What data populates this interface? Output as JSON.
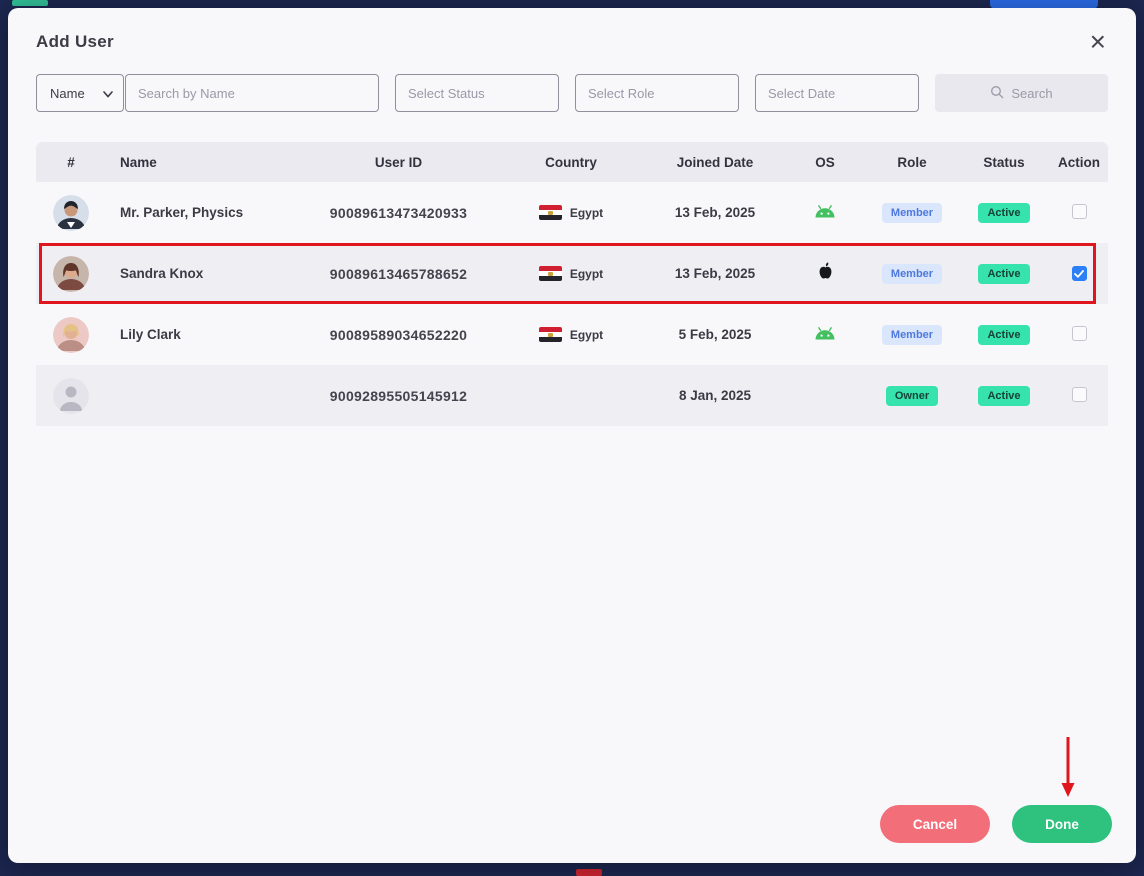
{
  "modal": {
    "title": "Add User"
  },
  "icons": {
    "close": "×"
  },
  "filters": {
    "name_dropdown": {
      "label": "Name"
    },
    "search_input": {
      "placeholder": "Search by Name",
      "value": ""
    },
    "status_input": {
      "placeholder": "Select Status",
      "value": ""
    },
    "role_input": {
      "placeholder": "Select Role",
      "value": ""
    },
    "date_input": {
      "placeholder": "Select Date",
      "value": ""
    },
    "search_button": {
      "label": "Search"
    }
  },
  "table": {
    "columns": [
      "#",
      "Name",
      "User ID",
      "Country",
      "Joined Date",
      "OS",
      "Role",
      "Status",
      "Action"
    ],
    "rows": [
      {
        "name": "Mr. Parker, Physics",
        "user_id": "90089613473420933",
        "country": "Egypt",
        "joined": "13 Feb, 2025",
        "os": "android",
        "role": "Member",
        "status": "Active",
        "checked": false
      },
      {
        "name": "Sandra Knox",
        "user_id": "90089613465788652",
        "country": "Egypt",
        "joined": "13 Feb, 2025",
        "os": "apple",
        "role": "Member",
        "status": "Active",
        "checked": true,
        "highlighted": true
      },
      {
        "name": "Lily Clark",
        "user_id": "90089589034652220",
        "country": "Egypt",
        "joined": "5 Feb, 2025",
        "os": "android",
        "role": "Member",
        "status": "Active",
        "checked": false
      },
      {
        "name": "",
        "user_id": "90092895505145912",
        "country": "",
        "joined": "8 Jan, 2025",
        "os": "",
        "role": "Owner",
        "status": "Active",
        "checked": false
      }
    ]
  },
  "footer": {
    "cancel_label": "Cancel",
    "done_label": "Done"
  },
  "colors": {
    "accent_blue": "#2d7ff7",
    "active_green": "#36e3ac",
    "member_blue": "#4f78dd",
    "cancel_red": "#f26e79",
    "done_green": "#2ec27e",
    "annotation_red": "#df161d",
    "frame_navy": "#1c2750"
  }
}
